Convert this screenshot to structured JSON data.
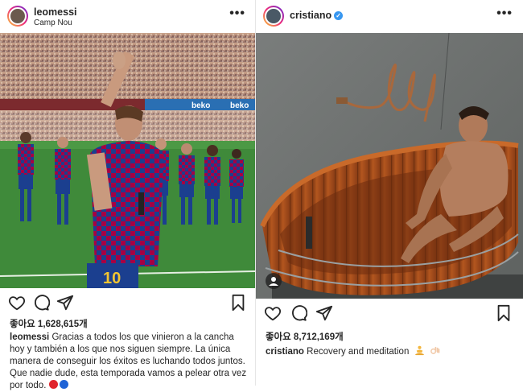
{
  "posts": [
    {
      "username": "leomessi",
      "location": "Camp Nou",
      "likes": "좋아요 1,628,615개",
      "caption_user": "leomessi",
      "caption_text": "Gracias a todos los que vinieron a la cancha hoy y también a los que nos siguen siempre. La única manera de conseguir los éxitos es luchando todos juntos. Que nadie dude, esta temporada vamos a pelear otra vez por todo.",
      "emoji": [
        "red-circle",
        "blue-circle"
      ],
      "photo": {
        "banner_texts": [
          "beko",
          "beko"
        ],
        "jersey_number": "10"
      }
    },
    {
      "username": "cristiano",
      "verified": true,
      "likes": "좋아요 8,712,169개",
      "caption_user": "cristiano",
      "caption_text": "Recovery and meditation",
      "emoji": [
        "person-in-lotus-position",
        "ok-hand"
      ]
    }
  ],
  "icons": {
    "like": "heart-icon",
    "comment": "comment-icon",
    "share": "share-icon",
    "save": "bookmark-icon",
    "more": "more-options-icon",
    "tag": "user-tag-icon"
  },
  "colors": {
    "verified": "#3897f0",
    "text": "#262626",
    "barca_blue": "#1b3f8f",
    "barca_red": "#a50044"
  }
}
